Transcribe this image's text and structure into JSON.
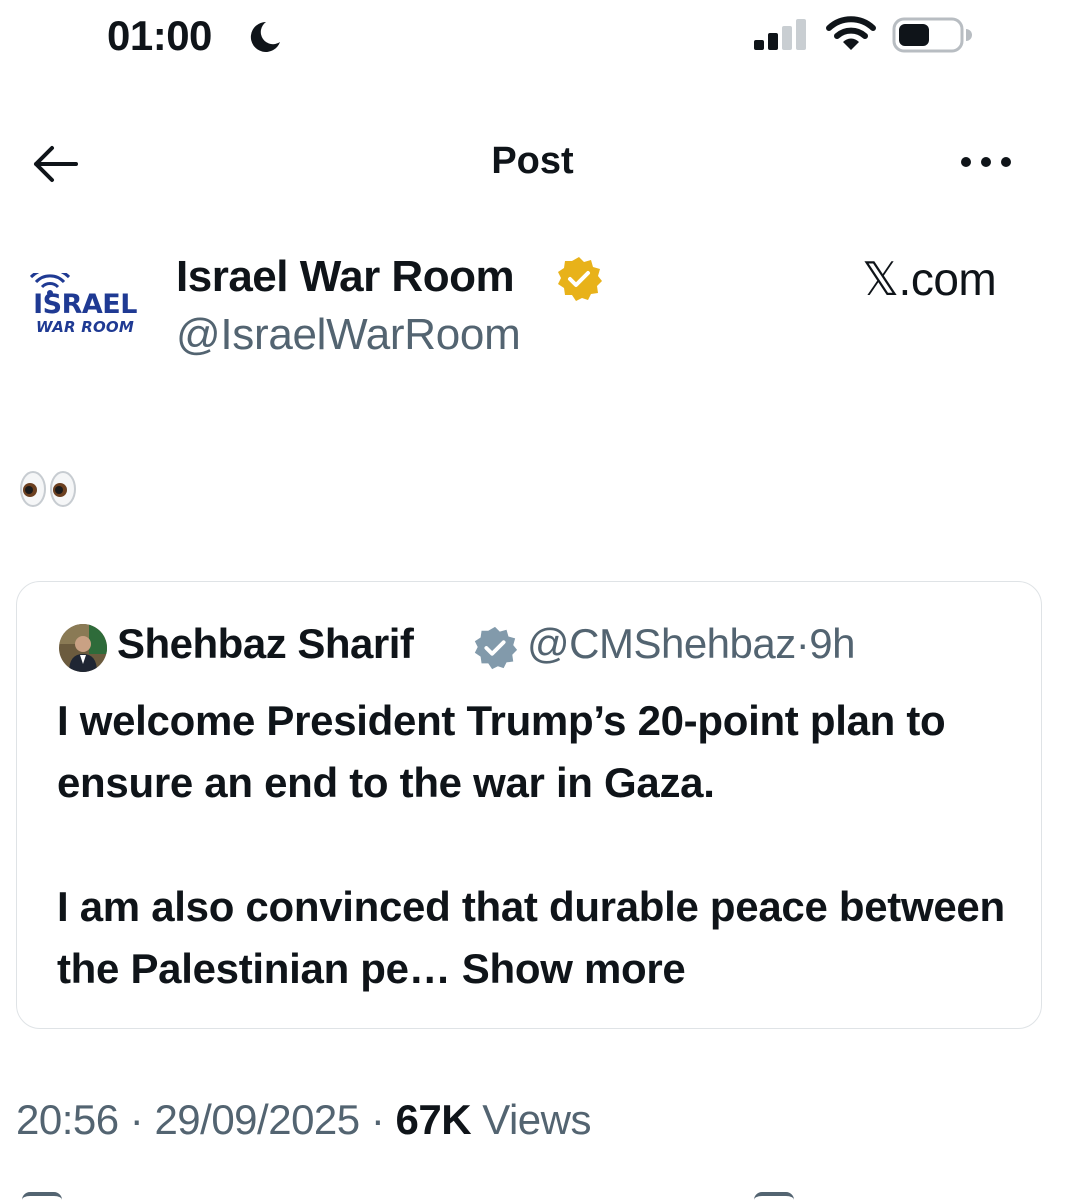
{
  "status_bar": {
    "time": "01:00",
    "focus_icon": "moon-icon",
    "signal_icon": "cellular-signal-icon",
    "wifi_icon": "wifi-icon",
    "battery_icon": "battery-icon"
  },
  "nav": {
    "title": "Post",
    "back_icon": "arrow-left-icon",
    "more_icon": "more-horizontal-icon"
  },
  "post": {
    "author_name": "Israel War Room",
    "author_handle": "@IsraelWarRoom",
    "avatar_logo_line1": "ISRAEL",
    "avatar_logo_line2": "WAR ROOM",
    "verified_color": "#e8b21a",
    "source": "𝕏.com",
    "body_emoji": "👀",
    "quote": {
      "author_name": "Shehbaz Sharif",
      "author_handle": "@CMShehbaz",
      "time_ago": "9h",
      "verified_color": "#829aab",
      "text": "I welcome President Trump’s 20-point plan to ensure an end to the war in Gaza.\n\nI am also convinced that durable peace between the Palestinian pe…",
      "show_more": "Show more"
    },
    "time": "20:56",
    "date": "29/09/2025",
    "views_count": "67K",
    "views_label": "Views"
  },
  "colors": {
    "text_primary": "#0f1419",
    "text_secondary": "#536471",
    "border": "#dfe3e6"
  }
}
